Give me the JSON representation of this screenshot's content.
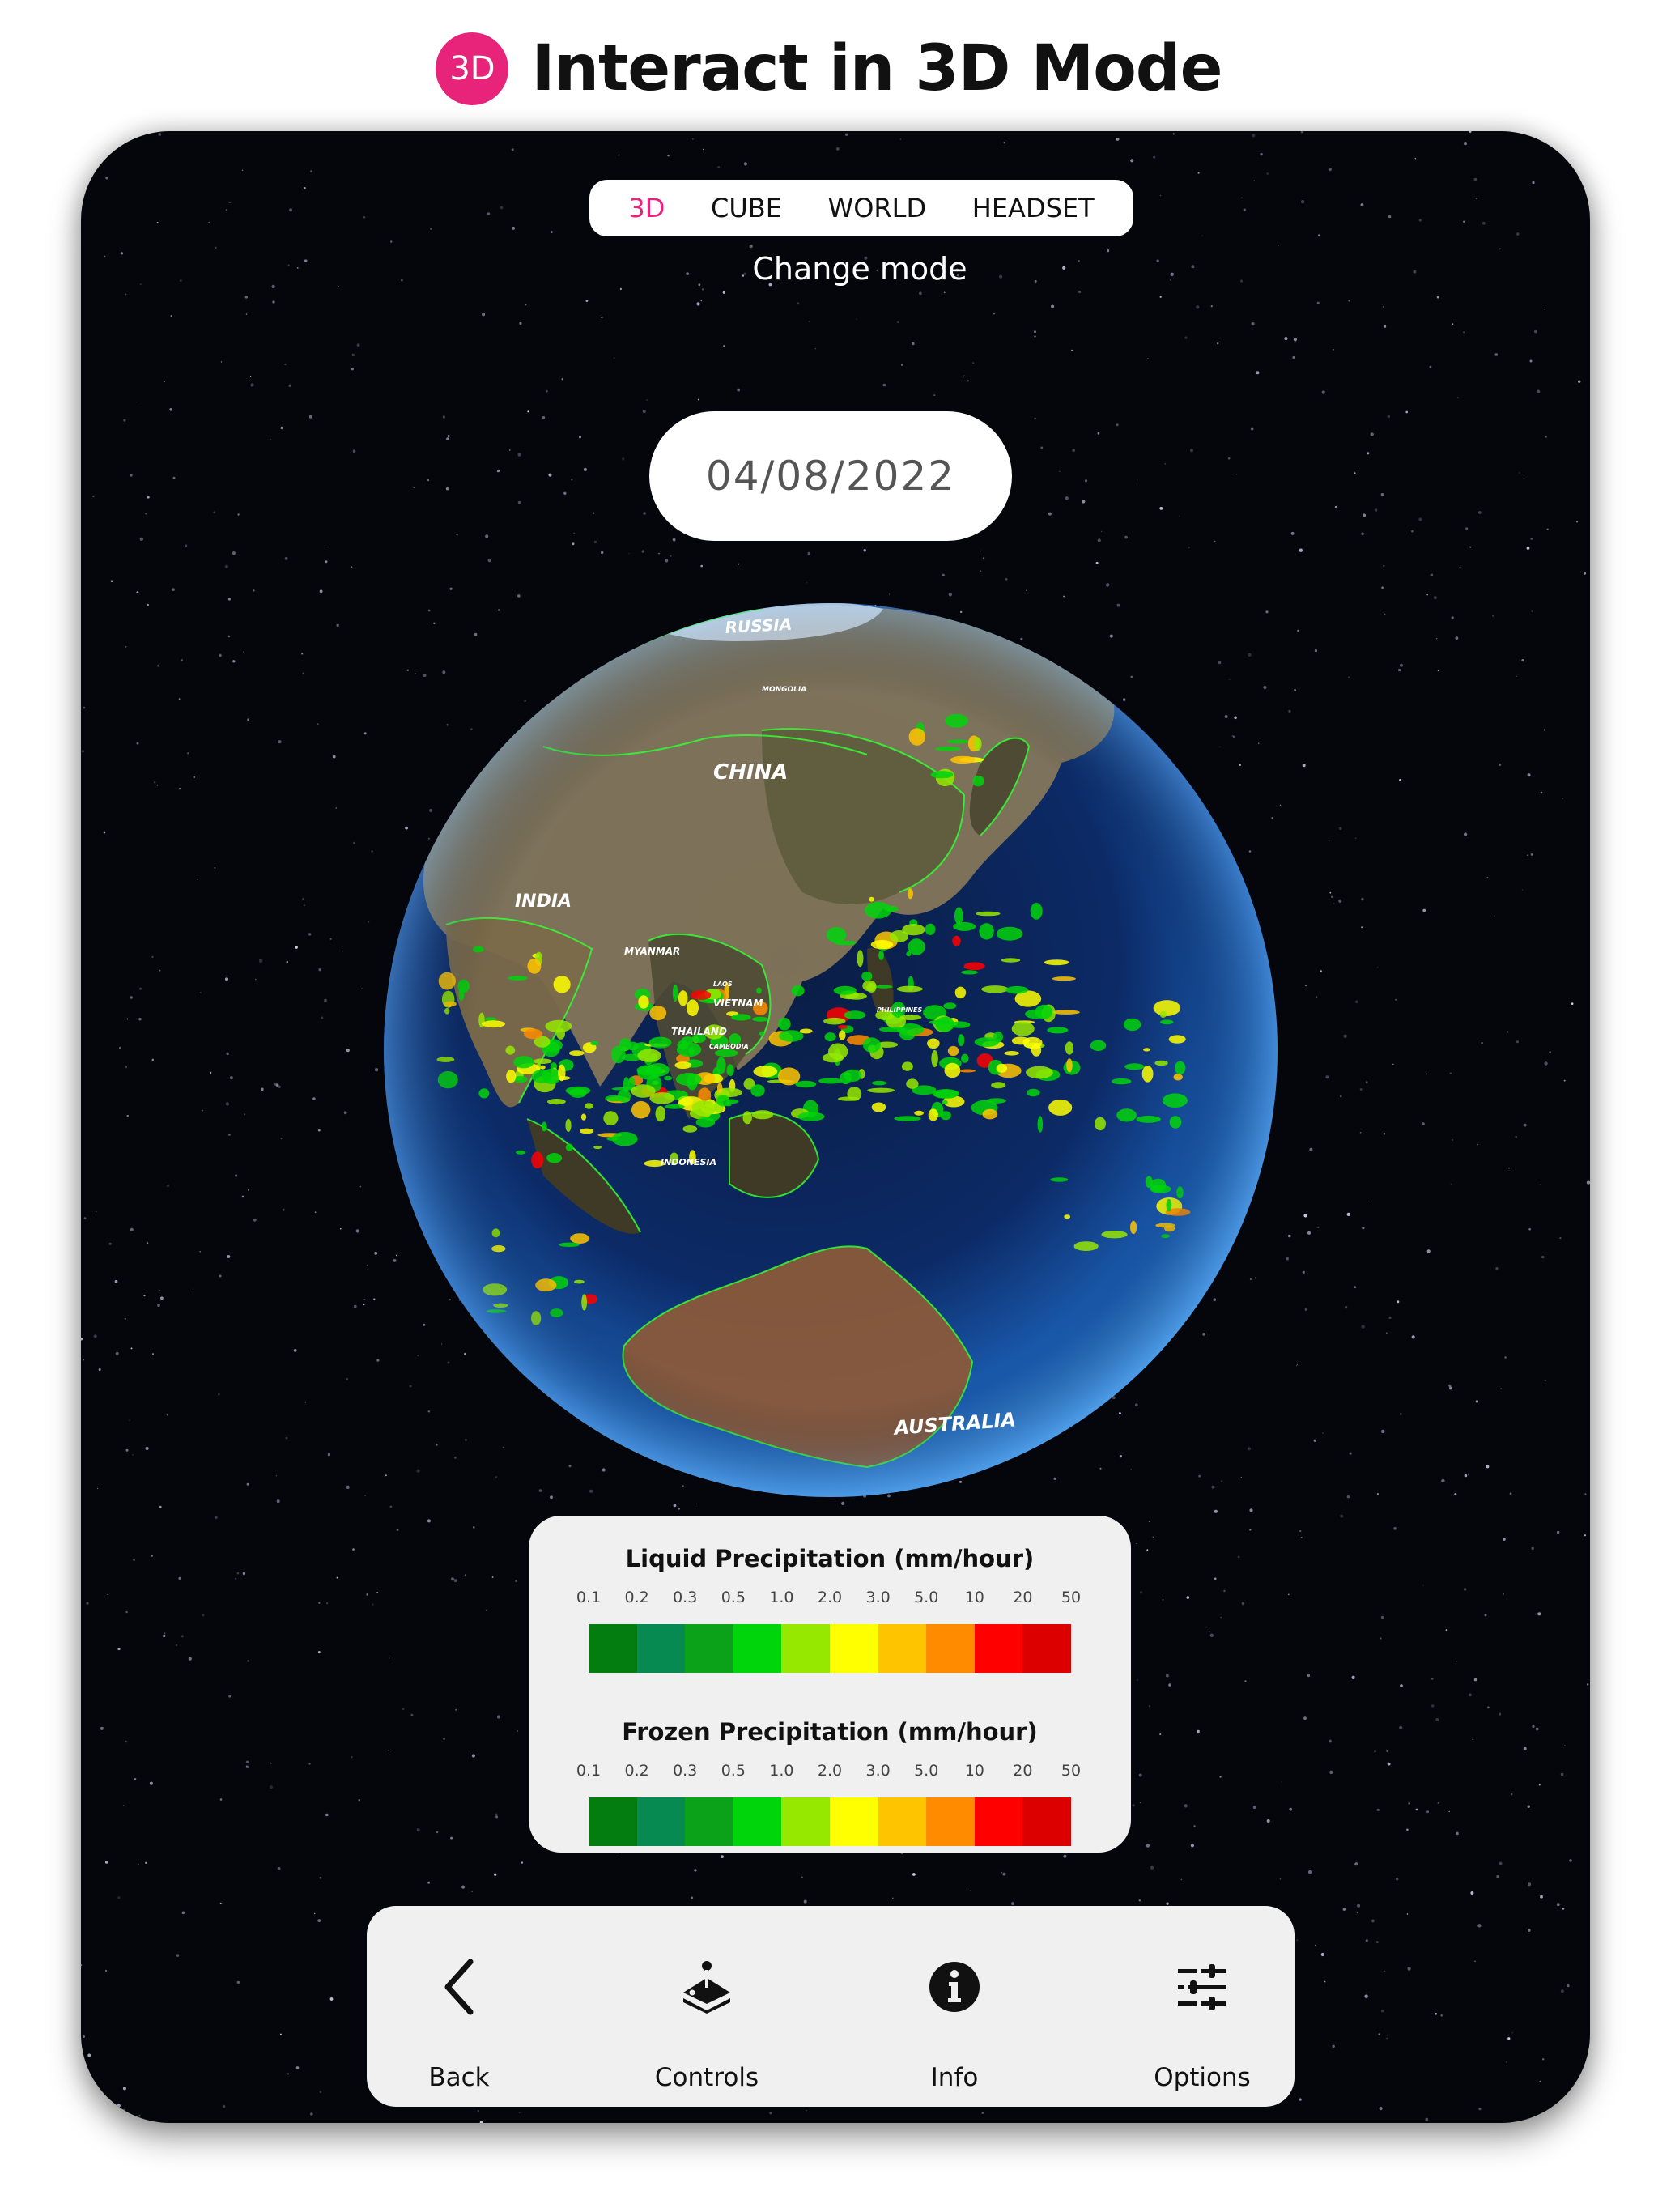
{
  "header": {
    "badge": "3D",
    "title": "Interact in 3D Mode"
  },
  "modes": {
    "items": [
      {
        "label": "3D",
        "active": true
      },
      {
        "label": "CUBE",
        "active": false
      },
      {
        "label": "WORLD",
        "active": false
      },
      {
        "label": "HEADSET",
        "active": false
      }
    ],
    "caption": "Change mode"
  },
  "date": "04/08/2022",
  "globe": {
    "labels": [
      "RUSSIA",
      "CHINA",
      "INDIA",
      "MONGOLIA",
      "MYANMAR",
      "LAOS",
      "VIETNAM",
      "THAILAND",
      "CAMBODIA",
      "INDONESIA",
      "PHILIPPINES",
      "AUSTRALIA"
    ]
  },
  "legend": {
    "liquid": {
      "title": "Liquid Precipitation (mm/hour)",
      "ticks": [
        "0.1",
        "0.2",
        "0.3",
        "0.5",
        "1.0",
        "2.0",
        "3.0",
        "5.0",
        "10",
        "20",
        "50"
      ],
      "colors": [
        "#047d10",
        "#078952",
        "#0ba219",
        "#00d40b",
        "#97e800",
        "#ffff00",
        "#ffc400",
        "#ff8c00",
        "#ff0000",
        "#dd0000"
      ]
    },
    "frozen": {
      "title": "Frozen Precipitation (mm/hour)",
      "ticks": [
        "0.1",
        "0.2",
        "0.3",
        "0.5",
        "1.0",
        "2.0",
        "3.0",
        "5.0",
        "10",
        "20",
        "50"
      ],
      "colors": [
        "#047d10",
        "#078952",
        "#0ba219",
        "#00d40b",
        "#97e800",
        "#ffff00",
        "#ffc400",
        "#ff8c00",
        "#ff0000",
        "#dd0000"
      ]
    }
  },
  "toolbar": {
    "items": [
      {
        "label": "Back",
        "icon": "chevron-left-icon"
      },
      {
        "label": "Controls",
        "icon": "joystick-icon"
      },
      {
        "label": "Info",
        "icon": "info-icon"
      },
      {
        "label": "Options",
        "icon": "sliders-icon"
      }
    ]
  },
  "colors": {
    "accent": "#e8247a",
    "space_background": "#05060c",
    "panel": "#f0f0f0"
  }
}
